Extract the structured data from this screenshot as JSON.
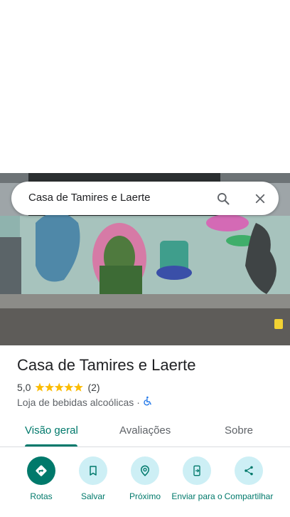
{
  "search": {
    "query": "Casa de Tamires e Laerte"
  },
  "place": {
    "name": "Casa de Tamires e Laerte",
    "rating": "5,0",
    "rating_value": 5,
    "review_count": "(2)",
    "category": "Loja de bebidas alcoólicas",
    "separator": "·"
  },
  "tabs": [
    {
      "label": "Visão geral",
      "active": true
    },
    {
      "label": "Avaliações",
      "active": false
    },
    {
      "label": "Sobre",
      "active": false
    }
  ],
  "actions": [
    {
      "label": "Rotas",
      "icon": "directions-icon"
    },
    {
      "label": "Salvar",
      "icon": "bookmark-icon"
    },
    {
      "label": "Próximo",
      "icon": "nearby-icon"
    },
    {
      "label": "Enviar para o",
      "icon": "send-to-phone-icon"
    },
    {
      "label": "Compartilhar",
      "icon": "share-icon"
    }
  ],
  "colors": {
    "accent": "#00796b",
    "star": "#fbbc04",
    "chip": "#cdeff5"
  }
}
